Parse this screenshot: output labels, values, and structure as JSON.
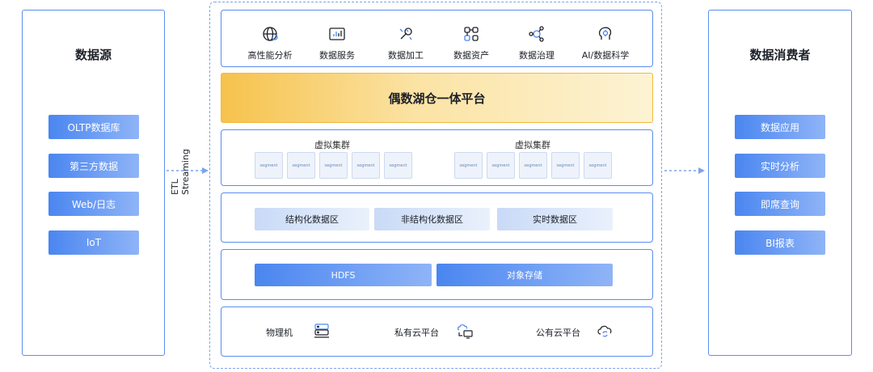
{
  "left_panel": {
    "title": "数据源",
    "items": [
      "OLTP数据库",
      "第三方数据",
      "Web/日志",
      "IoT"
    ]
  },
  "right_panel": {
    "title": "数据消费者",
    "items": [
      "数据应用",
      "实时分析",
      "即席查询",
      "BI报表"
    ]
  },
  "etl": {
    "line1": "ETL",
    "line2": "Streaming"
  },
  "tools": [
    {
      "label": "高性能分析",
      "icon": "globe-refresh-icon"
    },
    {
      "label": "数据服务",
      "icon": "bar-chart-icon"
    },
    {
      "label": "数据加工",
      "icon": "tools-icon"
    },
    {
      "label": "数据资产",
      "icon": "asset-network-icon"
    },
    {
      "label": "数据治理",
      "icon": "governance-icon"
    },
    {
      "label": "AI/数据科学",
      "icon": "ai-brain-icon"
    }
  ],
  "platform": {
    "title": "偶数湖仓一体平台"
  },
  "clusters": [
    {
      "title": "虚拟集群",
      "segments": [
        "segment",
        "segment",
        "segment",
        "segment",
        "segment"
      ]
    },
    {
      "title": "虚拟集群",
      "segments": [
        "segment",
        "segment",
        "segment",
        "segment",
        "segment"
      ]
    }
  ],
  "zones": [
    "结构化数据区",
    "非结构化数据区",
    "实时数据区"
  ],
  "storage": [
    "HDFS",
    "对象存储"
  ],
  "infra": [
    {
      "label": "物理机",
      "icon": "server-icon"
    },
    {
      "label": "私有云平台",
      "icon": "private-cloud-icon"
    },
    {
      "label": "公有云平台",
      "icon": "public-cloud-icon"
    }
  ],
  "colors": {
    "accent": "#5b8def",
    "button_start": "#4a86f0",
    "button_end": "#8fb4f7",
    "platform_start": "#f6c24c",
    "platform_end": "#fdf3d3"
  }
}
